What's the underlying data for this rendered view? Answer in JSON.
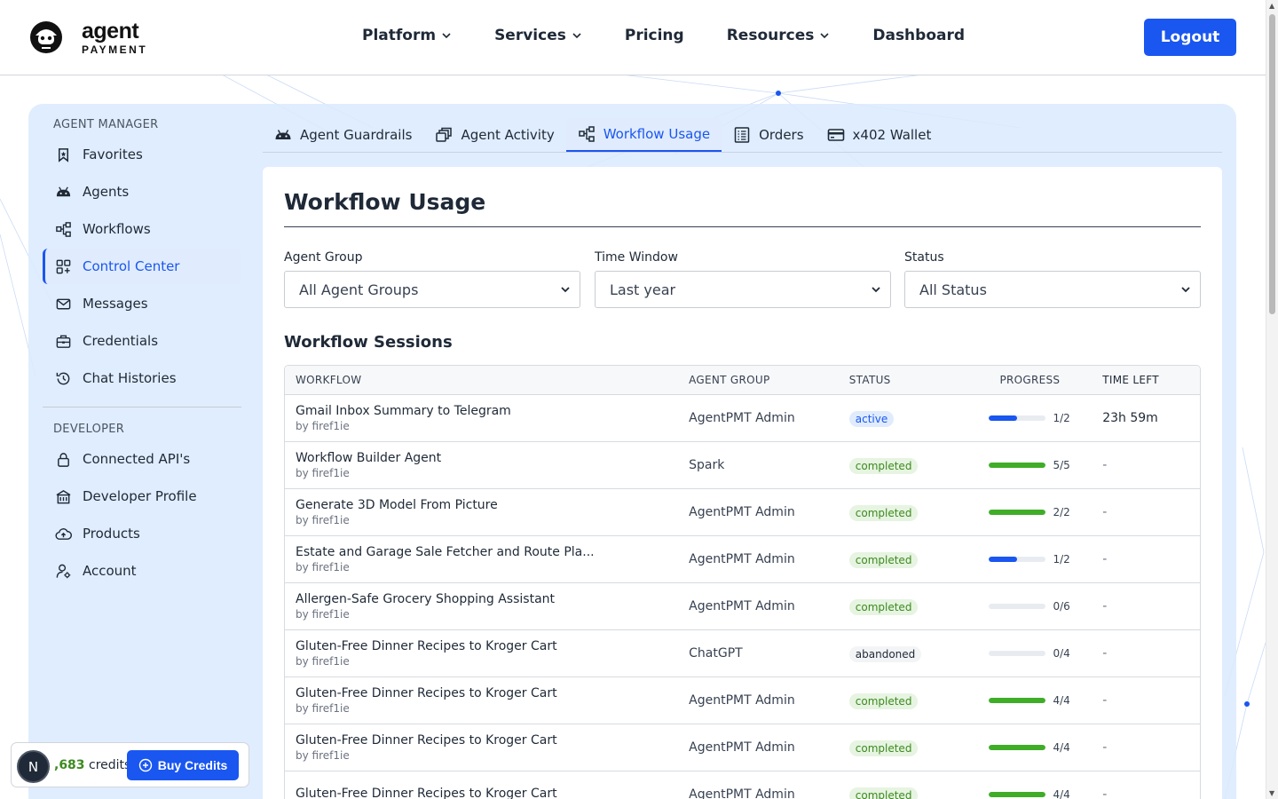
{
  "header": {
    "logo": {
      "word": "agent",
      "sub": "PAYMENT"
    },
    "nav": [
      {
        "label": "Platform",
        "dropdown": true
      },
      {
        "label": "Services",
        "dropdown": true
      },
      {
        "label": "Pricing",
        "dropdown": false
      },
      {
        "label": "Resources",
        "dropdown": true
      },
      {
        "label": "Dashboard",
        "dropdown": false
      }
    ],
    "logout_label": "Logout"
  },
  "sidebar": {
    "sections": [
      {
        "heading": "AGENT MANAGER",
        "items": [
          {
            "label": "Favorites",
            "icon": "bookmark-icon"
          },
          {
            "label": "Agents",
            "icon": "android-icon"
          },
          {
            "label": "Workflows",
            "icon": "workflow-icon"
          },
          {
            "label": "Control Center",
            "icon": "grid-icon",
            "active": true
          },
          {
            "label": "Messages",
            "icon": "envelope-icon"
          },
          {
            "label": "Credentials",
            "icon": "briefcase-icon"
          },
          {
            "label": "Chat Histories",
            "icon": "history-icon"
          }
        ]
      },
      {
        "heading": "DEVELOPER",
        "items": [
          {
            "label": "Connected API's",
            "icon": "lock-icon"
          },
          {
            "label": "Developer Profile",
            "icon": "building-icon"
          },
          {
            "label": "Products",
            "icon": "cloud-upload-icon"
          },
          {
            "label": "Account",
            "icon": "user-gear-icon"
          }
        ]
      }
    ]
  },
  "tabs": [
    {
      "label": "Agent Guardrails",
      "icon": "car-icon"
    },
    {
      "label": "Agent Activity",
      "icon": "activity-icon"
    },
    {
      "label": "Workflow Usage",
      "icon": "workflow-icon",
      "active": true
    },
    {
      "label": "Orders",
      "icon": "receipt-icon"
    },
    {
      "label": "x402 Wallet",
      "icon": "card-icon"
    }
  ],
  "main": {
    "title": "Workflow Usage",
    "filters": [
      {
        "label": "Agent Group",
        "value": "All Agent Groups"
      },
      {
        "label": "Time Window",
        "value": "Last year"
      },
      {
        "label": "Status",
        "value": "All Status"
      }
    ],
    "sessions_title": "Workflow Sessions",
    "columns": [
      "WORKFLOW",
      "AGENT GROUP",
      "STATUS",
      "PROGRESS",
      "TIME LEFT"
    ],
    "rows": [
      {
        "workflow": "Gmail Inbox Summary to Telegram",
        "by": "by firef1ie",
        "group": "AgentPMT Admin",
        "status": "active",
        "progress_text": "1/2",
        "progress": 0.5,
        "time_left": "23h 59m"
      },
      {
        "workflow": "Workflow Builder Agent",
        "by": "by firef1ie",
        "group": "Spark",
        "status": "completed",
        "progress_text": "5/5",
        "progress": 1.0,
        "time_left": "-"
      },
      {
        "workflow": "Generate 3D Model From Picture",
        "by": "by firef1ie",
        "group": "AgentPMT Admin",
        "status": "completed",
        "progress_text": "2/2",
        "progress": 1.0,
        "time_left": "-"
      },
      {
        "workflow": "Estate and Garage Sale Fetcher and Route Pla...",
        "by": "by firef1ie",
        "group": "AgentPMT Admin",
        "status": "completed",
        "progress_text": "1/2",
        "progress": 0.5,
        "time_left": "-"
      },
      {
        "workflow": "Allergen-Safe Grocery Shopping Assistant",
        "by": "by firef1ie",
        "group": "AgentPMT Admin",
        "status": "completed",
        "progress_text": "0/6",
        "progress": 0.0,
        "time_left": "-"
      },
      {
        "workflow": "Gluten-Free Dinner Recipes to Kroger Cart",
        "by": "by firef1ie",
        "group": "ChatGPT",
        "status": "abandoned",
        "progress_text": "0/4",
        "progress": 0.0,
        "time_left": "-"
      },
      {
        "workflow": "Gluten-Free Dinner Recipes to Kroger Cart",
        "by": "by firef1ie",
        "group": "AgentPMT Admin",
        "status": "completed",
        "progress_text": "4/4",
        "progress": 1.0,
        "time_left": "-"
      },
      {
        "workflow": "Gluten-Free Dinner Recipes to Kroger Cart",
        "by": "by firef1ie",
        "group": "AgentPMT Admin",
        "status": "completed",
        "progress_text": "4/4",
        "progress": 1.0,
        "time_left": "-"
      },
      {
        "workflow": "Gluten-Free Dinner Recipes to Kroger Cart",
        "by": "",
        "group": "AgentPMT Admin",
        "status": "completed",
        "progress_text": "4/4",
        "progress": 1.0,
        "time_left": "-"
      }
    ]
  },
  "credits": {
    "avatar_letter": "N",
    "amount": ",683",
    "unit": " credits",
    "buy_label": "Buy Credits"
  },
  "colors": {
    "accent": "#1a56f0",
    "progress_active": "#1a56f0",
    "progress_complete": "#3fad28",
    "panel_bg": "#dbeafe"
  }
}
